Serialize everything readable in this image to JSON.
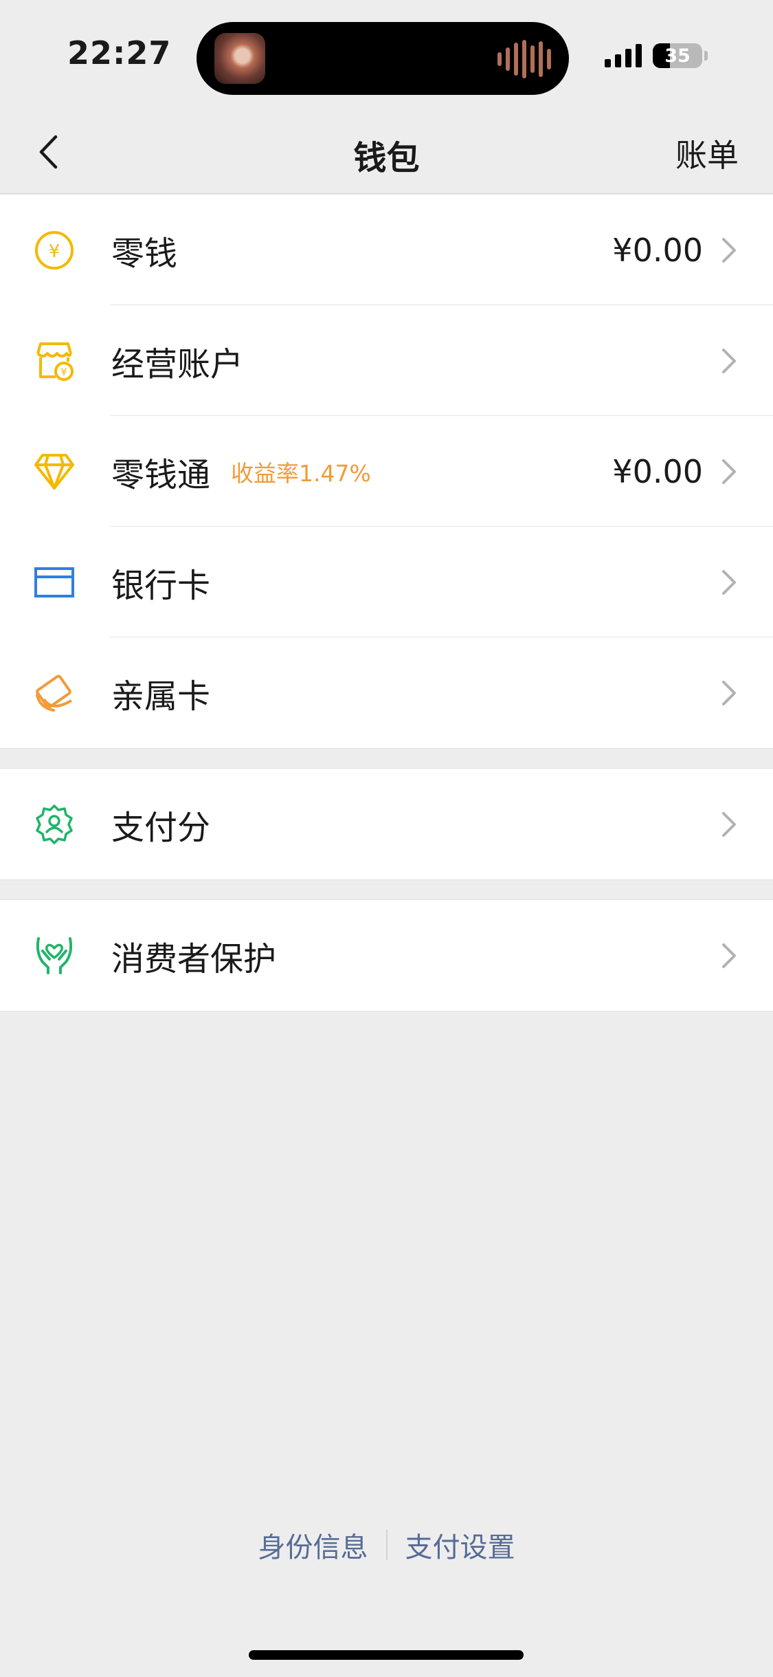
{
  "status_bar": {
    "time": "22:27",
    "battery_percent": 35,
    "battery_label": "35",
    "signal_bars": 4
  },
  "nav": {
    "title": "钱包",
    "right_action": "账单"
  },
  "groups": [
    {
      "rows": [
        {
          "label": "零钱",
          "value": "¥0.00",
          "icon": "coin-yuan-icon"
        },
        {
          "label": "经营账户",
          "value": "",
          "icon": "shop-account-icon"
        },
        {
          "label": "零钱通",
          "badge": "收益率1.47%",
          "value": "¥0.00",
          "icon": "diamond-icon"
        },
        {
          "label": "银行卡",
          "value": "",
          "icon": "bank-card-icon"
        },
        {
          "label": "亲属卡",
          "value": "",
          "icon": "family-card-icon"
        }
      ]
    },
    {
      "rows": [
        {
          "label": "支付分",
          "value": "",
          "icon": "pay-score-badge-icon"
        }
      ]
    },
    {
      "rows": [
        {
          "label": "消费者保护",
          "value": "",
          "icon": "consumer-protection-hands-icon"
        }
      ]
    }
  ],
  "footer": {
    "identity_link": "身份信息",
    "settings_link": "支付设置"
  },
  "colors": {
    "background": "#ededed",
    "yellow_icon": "#f5b800",
    "blue_icon": "#2f7fe0",
    "orange_icon": "#f29b38",
    "green_icon": "#1fb56a",
    "badge_orange": "#f29b38",
    "link_blue": "#576b95"
  }
}
